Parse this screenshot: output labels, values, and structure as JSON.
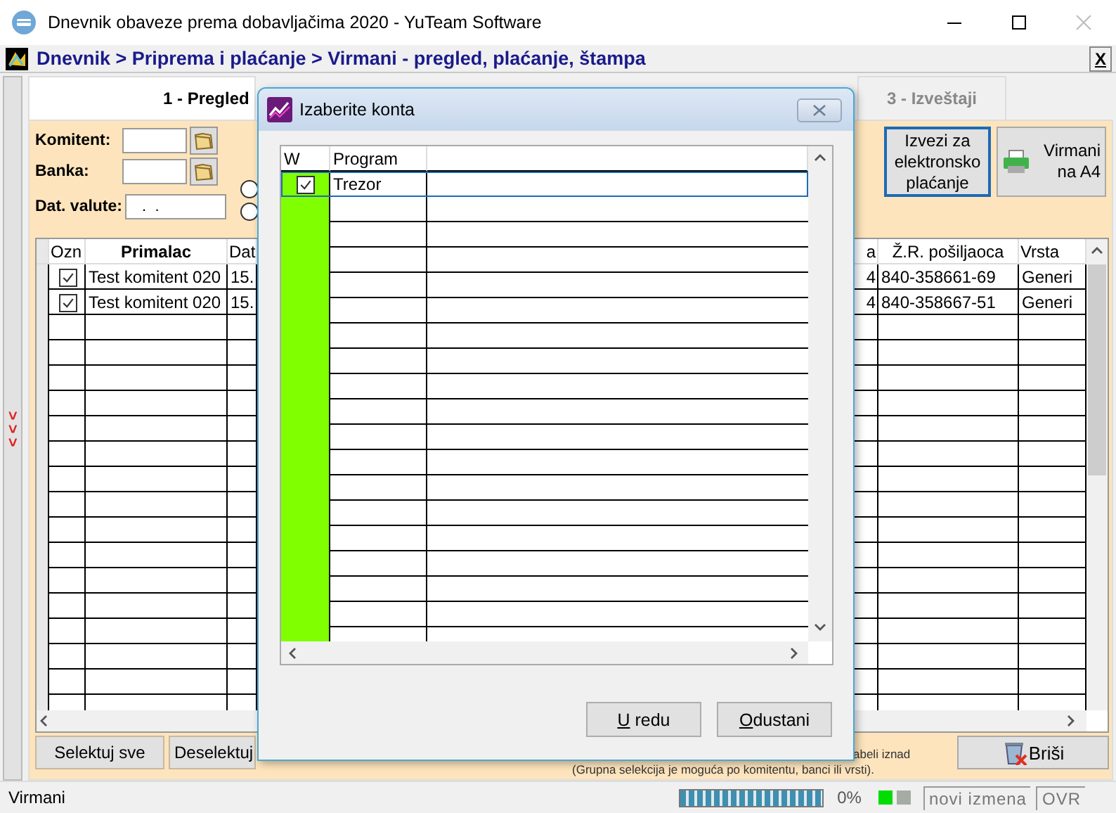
{
  "window": {
    "title": "Dnevnik obaveze prema dobavljačima 2020 - YuTeam Software"
  },
  "navbar": {
    "breadcrumb": "Dnevnik > Priprema i plaćanje > Virmani - pregled, plaćanje, štampa",
    "close_label": "X"
  },
  "side_strip": {
    "label": "> > >"
  },
  "tabs": [
    {
      "label": "1 - Pregled",
      "selected": true
    },
    {
      "label": "3 - Izveštaji",
      "selected": false
    }
  ],
  "filters": {
    "komitent_label": "Komitent:",
    "banka_label": "Banka:",
    "date_label": "Dat. valute:",
    "date_value": " .  .",
    "radios": [
      {
        "selected": false
      },
      {
        "selected": false
      }
    ]
  },
  "actions": [
    {
      "label": "Izvezi za elektronsko plaćanje",
      "kind": "plain",
      "focused": true
    },
    {
      "label": "Virmani na A4",
      "kind": "print",
      "focused": false
    }
  ],
  "table": {
    "check_column": "Ozn",
    "columns": [
      "Primalac",
      "Dat",
      "a",
      "Ž.R. pošiljaoca",
      "Vrsta"
    ],
    "rows": [
      {
        "checked": true,
        "cells": [
          "Test komitent 020",
          "15.",
          "4",
          "840-358661-69",
          "Generi"
        ]
      },
      {
        "checked": true,
        "cells": [
          "Test komitent 020",
          "15.",
          "4",
          "840-358667-51",
          "Generi"
        ]
      }
    ]
  },
  "bottom_buttons": [
    "Selektuj sve",
    "Deselektuj"
  ],
  "note": [
    "abeli iznad",
    "(Grupna selekcija je moguća po komitentu, banci ili vrsti)."
  ],
  "delete_button": "Briši",
  "dialog": {
    "title": "Izaberite konta",
    "columns": [
      "W",
      "Program"
    ],
    "rows": [
      {
        "checked": true,
        "program": "Trezor",
        "selected": true
      }
    ],
    "buttons": [
      "U redu",
      "Odustani"
    ]
  },
  "status_bar": {
    "text": "Virmani",
    "progress": {
      "level": 1,
      "text": "0%"
    },
    "indicators": [
      {
        "color": "#00dd00"
      },
      {
        "color": "#a4aca4"
      }
    ],
    "mode": "novi izmena",
    "ovr": "OVR"
  }
}
